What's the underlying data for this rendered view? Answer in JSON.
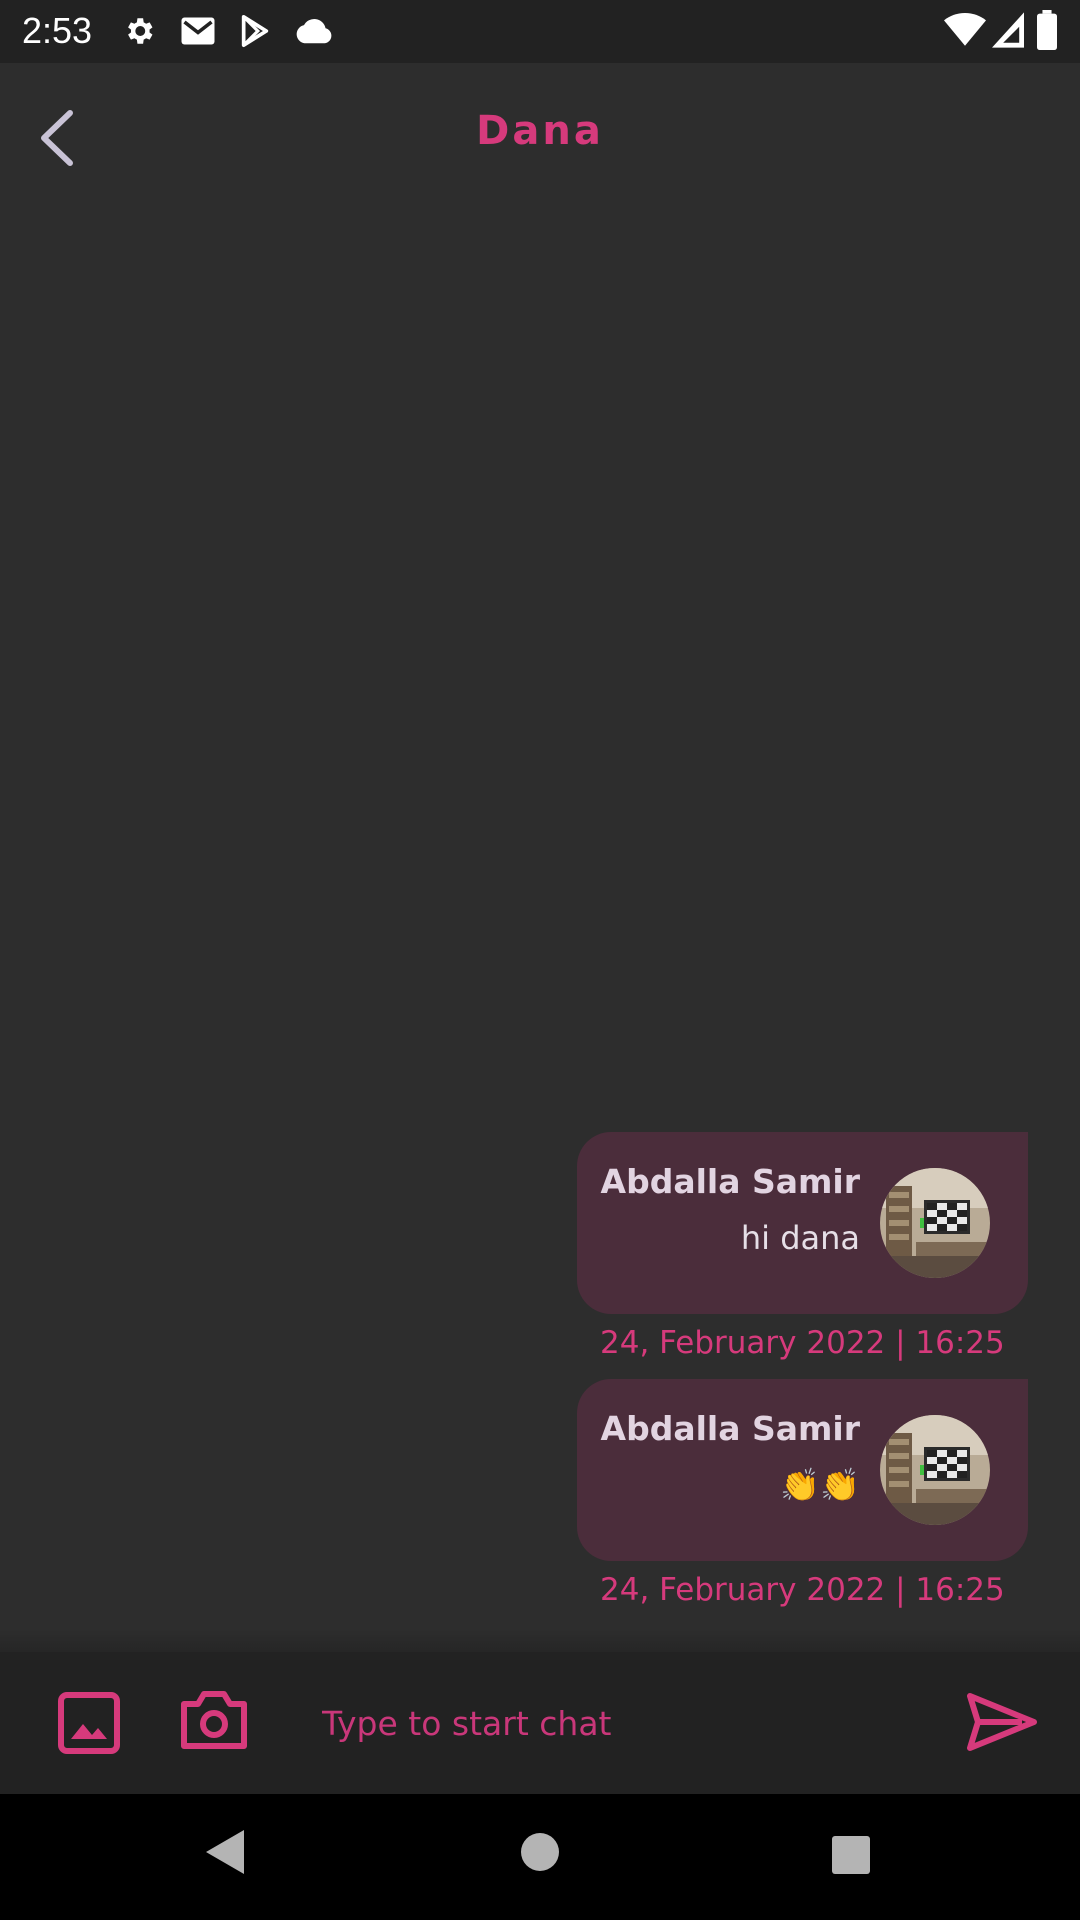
{
  "status_bar": {
    "time": "2:53",
    "left_icons": [
      "gear-icon",
      "gmail-icon",
      "play-store-icon",
      "cloud-icon"
    ],
    "right_icons": [
      "wifi-icon",
      "signal-icon",
      "battery-icon"
    ]
  },
  "header": {
    "title": "Dana",
    "back_icon": "chevron-left-icon"
  },
  "messages": [
    {
      "sender": "Abdalla Samir",
      "text": "hi dana",
      "timestamp": "24, February 2022 | 16:25"
    },
    {
      "sender": "Abdalla Samir",
      "text": "👏👏",
      "timestamp": "24, February 2022 | 16:25"
    }
  ],
  "composer": {
    "placeholder": "Type to start chat",
    "value": "",
    "icons": [
      "image-icon",
      "camera-icon",
      "send-icon"
    ]
  },
  "nav_bar": {
    "icons": [
      "back-triangle-icon",
      "home-circle-icon",
      "recents-square-icon"
    ]
  },
  "colors": {
    "accent": "#d63a7c",
    "background": "#2d2d2d",
    "bubble": "#4b2d3b",
    "bar": "#222222"
  }
}
